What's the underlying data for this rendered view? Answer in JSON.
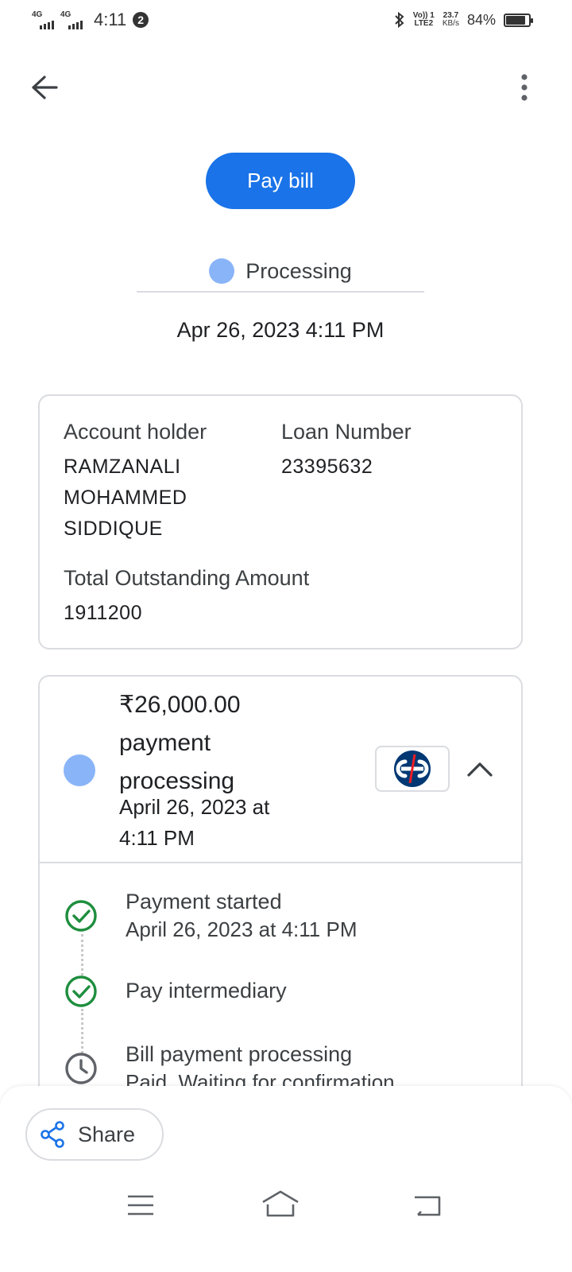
{
  "status_bar": {
    "sim1": "4G",
    "sim2": "4G",
    "time": "4:11",
    "notif_count": "2",
    "volte_line1": "Vo)) 1",
    "volte_line2": "LTE2",
    "net_speed_value": "23.7",
    "net_speed_unit": "KB/s",
    "battery_percent": "84%",
    "battery_level": 0.84
  },
  "header": {
    "back_icon": "arrow-back-icon",
    "more_icon": "more-vert-icon"
  },
  "pay_bill_label": "Pay bill",
  "status": {
    "label": "Processing",
    "dot_color": "#8ab4f8"
  },
  "date": "Apr 26, 2023 4:11 PM",
  "account": {
    "holder_label": "Account holder",
    "holder_line1": "RAMZANALI",
    "holder_line2": "MOHAMMED",
    "holder_line3": "SIDDIQUE",
    "loan_label": "Loan Number",
    "loan_value": "23395632",
    "outstanding_label": "Total Outstanding Amount",
    "outstanding_value": "1911200"
  },
  "payment": {
    "amount": "₹26,000.00",
    "status_line1": "payment",
    "status_line2": "processing",
    "date_line1": "April 26, 2023 at",
    "date_line2": "4:11 PM",
    "bank_logo": "kotak-bank-logo",
    "collapse_icon": "chevron-up-icon",
    "steps": [
      {
        "title": "Payment started",
        "subtitle": "April 26, 2023 at 4:11 PM",
        "icon": "check-circle-icon"
      },
      {
        "title": "Pay intermediary",
        "icon": "check-circle-icon"
      },
      {
        "title": "Bill payment processing",
        "subtitle": "Paid. Waiting for confirmation.",
        "icon": "clock-icon"
      }
    ]
  },
  "share_label": "Share",
  "colors": {
    "accent": "#1a73e8",
    "success": "#1e8e3e",
    "processing_dot": "#8ab4f8",
    "kotak_blue": "#003874",
    "kotak_red": "#ed1c24"
  },
  "nav_icons": [
    "menu-icon",
    "home-icon",
    "back-icon"
  ]
}
